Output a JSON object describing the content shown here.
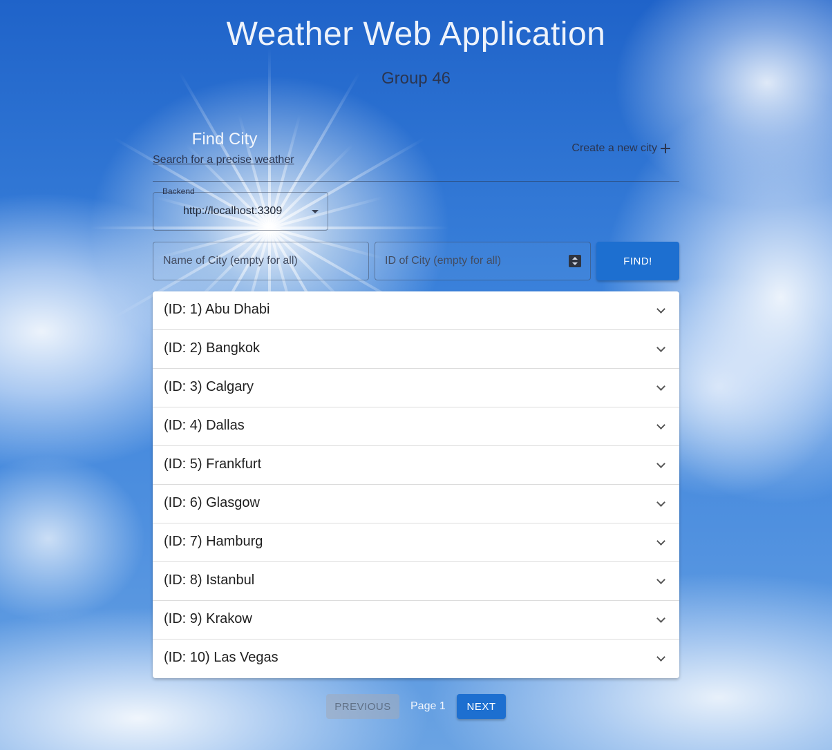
{
  "header": {
    "title": "Weather Web Application",
    "subtitle": "Group 46"
  },
  "find": {
    "title": "Find City",
    "link": "Search for a precise weather",
    "create_label": "Create a new city",
    "create_icon": "plus-icon"
  },
  "backend": {
    "label": "Backend",
    "value": "http://localhost:3309"
  },
  "search": {
    "name_placeholder": "Name of City (empty for all)",
    "id_placeholder": "ID of City (empty for all)",
    "find_label": "FIND!"
  },
  "cities": [
    {
      "label": "(ID: 1) Abu Dhabi"
    },
    {
      "label": "(ID: 2) Bangkok"
    },
    {
      "label": "(ID: 3) Calgary"
    },
    {
      "label": "(ID: 4) Dallas"
    },
    {
      "label": "(ID: 5) Frankfurt"
    },
    {
      "label": "(ID: 6) Glasgow"
    },
    {
      "label": "(ID: 7) Hamburg"
    },
    {
      "label": "(ID: 8) Istanbul"
    },
    {
      "label": "(ID: 9) Krakow"
    },
    {
      "label": "(ID: 10) Las Vegas"
    }
  ],
  "pagination": {
    "previous_label": "PREVIOUS",
    "page_label": "Page 1",
    "next_label": "NEXT"
  },
  "colors": {
    "primary": "#1d6fd0",
    "sky": "#2f74d6"
  }
}
